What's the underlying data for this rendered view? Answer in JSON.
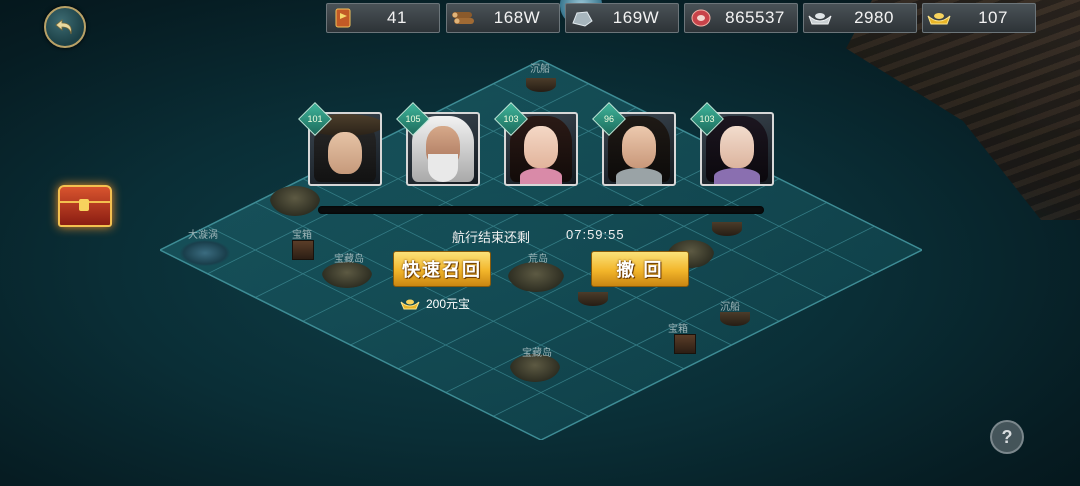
{
  "resources": [
    {
      "name": "order-token",
      "icon": "flag-token-icon",
      "value": "41"
    },
    {
      "name": "wood",
      "icon": "log-icon",
      "value": "168W"
    },
    {
      "name": "stone",
      "icon": "stone-icon",
      "value": "169W"
    },
    {
      "name": "meat",
      "icon": "meat-icon",
      "value": "865537"
    },
    {
      "name": "silver",
      "icon": "silver-ingot-icon",
      "value": "2980"
    },
    {
      "name": "gold",
      "icon": "gold-ingot-icon",
      "value": "107"
    }
  ],
  "heroes": [
    {
      "level": "101",
      "portrait": "hero-straw-hat-swordsman"
    },
    {
      "level": "105",
      "portrait": "hero-white-haired-elder"
    },
    {
      "level": "103",
      "portrait": "hero-maiden-pink"
    },
    {
      "level": "96",
      "portrait": "hero-young-swordsman"
    },
    {
      "level": "103",
      "portrait": "hero-lady-purple"
    }
  ],
  "voyage": {
    "label": "航行结束还剩",
    "remaining": "07:59:55",
    "progress": 0
  },
  "buttons": {
    "quick_recall": "快速召回",
    "withdraw": "撤 回"
  },
  "cost": {
    "text": "200元宝"
  },
  "map_labels": {
    "a": "沉船",
    "b": "宝箱",
    "c": "宝藏岛",
    "d": "大漩涡",
    "e": "荒岛",
    "f": "宝箱",
    "g": "沉船",
    "h": "宝藏岛"
  },
  "help": {
    "label": "?"
  },
  "colors": {
    "sea": "#0a2e36",
    "button_gold": "#f2b52a",
    "level_badge": "#3fb49a"
  }
}
